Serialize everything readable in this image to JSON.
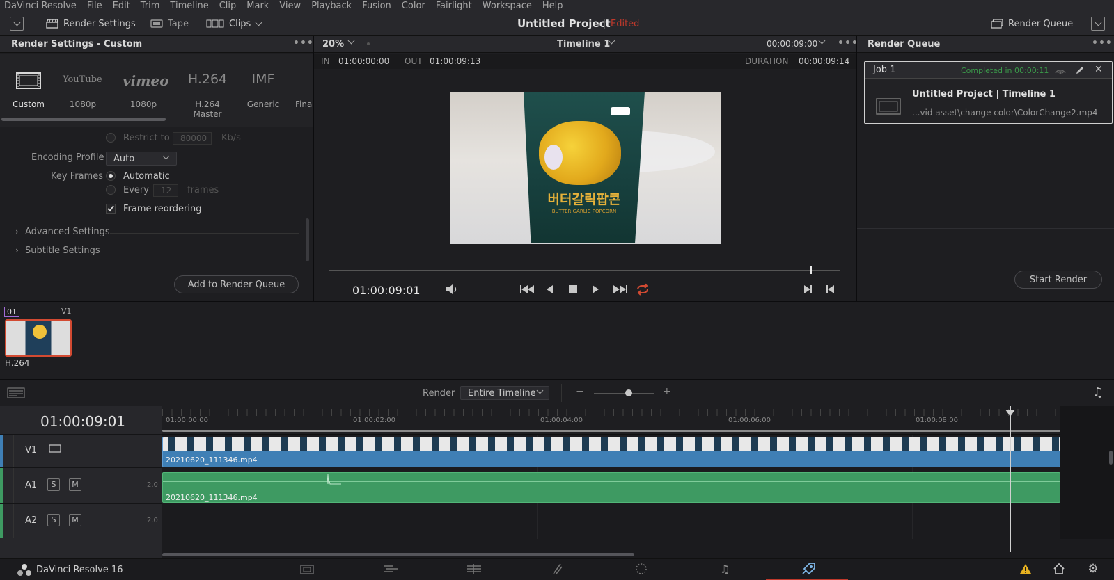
{
  "menu": [
    "DaVinci Resolve",
    "File",
    "Edit",
    "Trim",
    "Timeline",
    "Clip",
    "Mark",
    "View",
    "Playback",
    "Fusion",
    "Color",
    "Fairlight",
    "Workspace",
    "Help"
  ],
  "toolbar": {
    "render_settings": "Render Settings",
    "tape": "Tape",
    "clips": "Clips",
    "project_title": "Untitled Project",
    "edited_badge": "Edited",
    "render_queue": "Render Queue"
  },
  "render_settings": {
    "title": "Render Settings - Custom",
    "presets": [
      {
        "logo": "",
        "sub": "Custom"
      },
      {
        "logo": "YouTube",
        "sub": "1080p"
      },
      {
        "logo": "vimeo",
        "sub": "1080p"
      },
      {
        "logo": "H.264",
        "sub": "H.264 Master"
      },
      {
        "logo": "IMF",
        "sub": "Generic"
      },
      {
        "logo": "",
        "sub": "Final"
      }
    ],
    "restrict_label": "Restrict to",
    "restrict_value": "80000",
    "restrict_unit": "Kb/s",
    "encoding_profile_label": "Encoding Profile",
    "encoding_profile_value": "Auto",
    "key_frames_label": "Key Frames",
    "key_frames_auto": "Automatic",
    "key_frames_every": "Every",
    "key_frames_every_value": "12",
    "key_frames_unit": "frames",
    "frame_reordering": "Frame reordering",
    "advanced_settings": "Advanced Settings",
    "subtitle_settings": "Subtitle Settings",
    "add_to_queue": "Add to Render Queue"
  },
  "viewer": {
    "zoom": "20%",
    "timeline_name": "Timeline 1",
    "timecode_top": "00:00:09:00",
    "in_label": "IN",
    "in_value": "01:00:00:00",
    "out_label": "OUT",
    "out_value": "01:00:09:13",
    "duration_label": "DURATION",
    "duration_value": "00:00:09:14",
    "current_timecode": "01:00:09:01",
    "product_text_ko": "버터갈릭팝콘",
    "product_text_en": "BUTTER GARLIC POPCORN",
    "scrub_position": 0.94
  },
  "render_queue": {
    "title": "Render Queue",
    "job_name": "Job 1",
    "job_status": "Completed in 00:00:11",
    "job_title": "Untitled Project | Timeline 1",
    "job_path": "...vid asset\\change color\\ColorChange2.mp4",
    "start_render": "Start Render"
  },
  "clip_strip": {
    "clip_number": "01",
    "track": "V1",
    "codec": "H.264"
  },
  "timeline": {
    "render_label": "Render",
    "render_mode": "Entire Timeline",
    "timecode": "01:00:09:01",
    "ruler": [
      "01:00:00:00",
      "01:00:02:00",
      "01:00:04:00",
      "01:00:06:00",
      "01:00:08:00"
    ],
    "tracks": [
      {
        "name": "V1",
        "clip": "20210620_111346.mp4"
      },
      {
        "name": "A1",
        "clip": "20210620_111346.mp4",
        "channels": "2.0",
        "solo": "S",
        "mute": "M"
      },
      {
        "name": "A2",
        "channels": "2.0",
        "solo": "S",
        "mute": "M"
      }
    ],
    "playhead_position": 0.944
  },
  "bottom_bar": {
    "app_name": "DaVinci Resolve 16",
    "pages": [
      "media",
      "cut",
      "edit",
      "fusion",
      "color",
      "fairlight",
      "deliver"
    ]
  },
  "colors": {
    "accent_red": "#c0392b",
    "video_clip": "#3f7fb5",
    "audio_clip": "#3e9a62",
    "status_green": "#3b9a4a"
  }
}
